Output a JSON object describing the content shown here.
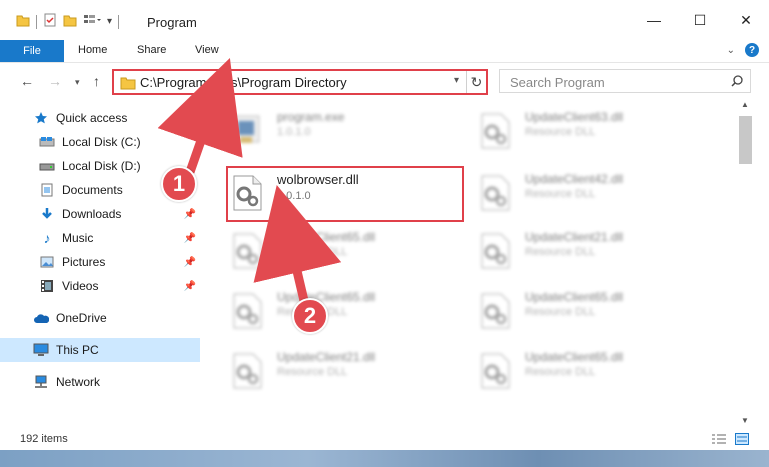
{
  "window": {
    "title": "Program"
  },
  "ribbon": {
    "tabs": [
      "File",
      "Home",
      "Share",
      "View"
    ]
  },
  "address": {
    "path": "C:\\Program Files\\Program Directory"
  },
  "search": {
    "placeholder": "Search Program"
  },
  "sidebar": {
    "items": [
      {
        "label": "Quick access",
        "icon": "star-icon",
        "pinned": false
      },
      {
        "label": "Local Disk (C:)",
        "icon": "drive-icon",
        "pinned": false
      },
      {
        "label": "Local Disk (D:)",
        "icon": "drive-icon",
        "pinned": false
      },
      {
        "label": "Documents",
        "icon": "documents-icon",
        "pinned": true
      },
      {
        "label": "Downloads",
        "icon": "download-icon",
        "pinned": true
      },
      {
        "label": "Music",
        "icon": "music-icon",
        "pinned": true
      },
      {
        "label": "Pictures",
        "icon": "pictures-icon",
        "pinned": true
      },
      {
        "label": "Videos",
        "icon": "videos-icon",
        "pinned": true
      },
      {
        "label": "OneDrive",
        "icon": "cloud-icon",
        "pinned": false
      },
      {
        "label": "This PC",
        "icon": "pc-icon",
        "pinned": false,
        "selected": true
      },
      {
        "label": "Network",
        "icon": "network-icon",
        "pinned": false
      }
    ]
  },
  "files": [
    {
      "name": "program.exe",
      "desc": "1.0.1.0",
      "type": "exe"
    },
    {
      "name": "UpdateClient63.dll",
      "desc": "Resource DLL",
      "type": "dll"
    },
    {
      "name": "wolbrowser.dll",
      "desc": "1.0.1.0",
      "type": "dll",
      "highlighted": true
    },
    {
      "name": "UpdateClient42.dll",
      "desc": "Resource DLL",
      "type": "dll"
    },
    {
      "name": "UpdateClient65.dll",
      "desc": "Resource DLL",
      "type": "dll"
    },
    {
      "name": "UpdateClient21.dll",
      "desc": "Resource DLL",
      "type": "dll"
    },
    {
      "name": "UpdateClient65.dll",
      "desc": "Resource DLL",
      "type": "dll"
    },
    {
      "name": "UpdateClient65.dll",
      "desc": "Resource DLL",
      "type": "dll"
    },
    {
      "name": "UpdateClient21.dll",
      "desc": "Resource DLL",
      "type": "dll"
    },
    {
      "name": "UpdateClient65.dll",
      "desc": "Resource DLL",
      "type": "dll"
    }
  ],
  "status": {
    "items": "192 items"
  },
  "markers": [
    "1",
    "2"
  ],
  "colors": {
    "accent": "#1979ca",
    "highlight": "#e0404a",
    "selected": "#cde8ff"
  }
}
